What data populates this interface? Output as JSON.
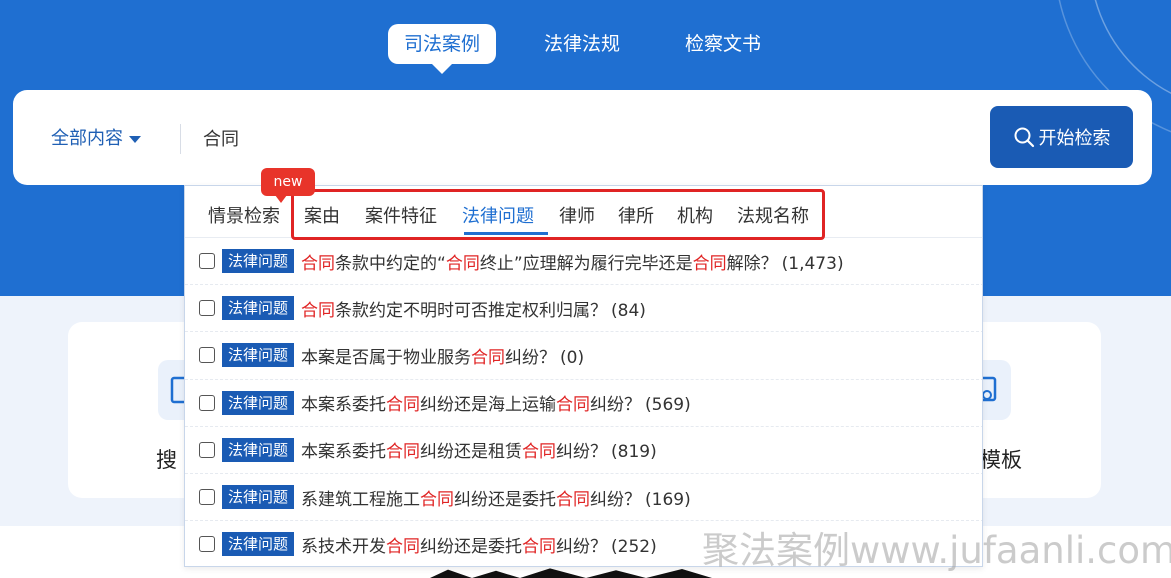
{
  "top_tabs": [
    {
      "label": "司法案例",
      "active": true
    },
    {
      "label": "法律法规",
      "active": false
    },
    {
      "label": "检察文书",
      "active": false
    }
  ],
  "search": {
    "scope_label": "全部内容",
    "query": "合同",
    "button_label": "开始检索"
  },
  "categories": {
    "new_badge": "new",
    "items": [
      "情景检索",
      "案由",
      "案件特征",
      "法律问题",
      "律师",
      "律所",
      "机构",
      "法规名称"
    ],
    "active": "法律问题"
  },
  "results": [
    {
      "tag": "法律问题",
      "segments": [
        [
          "合同",
          true
        ],
        [
          "条款中约定的“",
          false
        ],
        [
          "合同",
          true
        ],
        [
          "终止”应理解为履行完毕还是",
          false
        ],
        [
          "合同",
          true
        ],
        [
          "解除？",
          false
        ]
      ],
      "count": "(1,473)"
    },
    {
      "tag": "法律问题",
      "segments": [
        [
          "合同",
          true
        ],
        [
          "条款约定不明时可否推定权利归属？",
          false
        ]
      ],
      "count": "(84)"
    },
    {
      "tag": "法律问题",
      "segments": [
        [
          "本案是否属于物业服务",
          false
        ],
        [
          "合同",
          true
        ],
        [
          "纠纷？",
          false
        ]
      ],
      "count": "(0)"
    },
    {
      "tag": "法律问题",
      "segments": [
        [
          "本案系委托",
          false
        ],
        [
          "合同",
          true
        ],
        [
          "纠纷还是海上运输",
          false
        ],
        [
          "合同",
          true
        ],
        [
          "纠纷？",
          false
        ]
      ],
      "count": "(569)"
    },
    {
      "tag": "法律问题",
      "segments": [
        [
          "本案系委托",
          false
        ],
        [
          "合同",
          true
        ],
        [
          "纠纷还是租赁",
          false
        ],
        [
          "合同",
          true
        ],
        [
          "纠纷？",
          false
        ]
      ],
      "count": "(819)"
    },
    {
      "tag": "法律问题",
      "segments": [
        [
          "系建筑工程施工",
          false
        ],
        [
          "合同",
          true
        ],
        [
          "纠纷还是委托",
          false
        ],
        [
          "合同",
          true
        ],
        [
          "纠纷？",
          false
        ]
      ],
      "count": "(169)"
    },
    {
      "tag": "法律问题",
      "segments": [
        [
          "系技术开发",
          false
        ],
        [
          "合同",
          true
        ],
        [
          "纠纷还是委托",
          false
        ],
        [
          "合同",
          true
        ],
        [
          "纠纷？",
          false
        ]
      ],
      "count": "(252)"
    }
  ],
  "features": {
    "left_label_partial": "搜",
    "right_label_partial": "模板"
  },
  "watermark": "聚法案例www.jufaanli.com",
  "colors": {
    "brand_blue": "#1f6fd1",
    "button_blue": "#1a5bb4",
    "highlight_red": "#e02424"
  }
}
